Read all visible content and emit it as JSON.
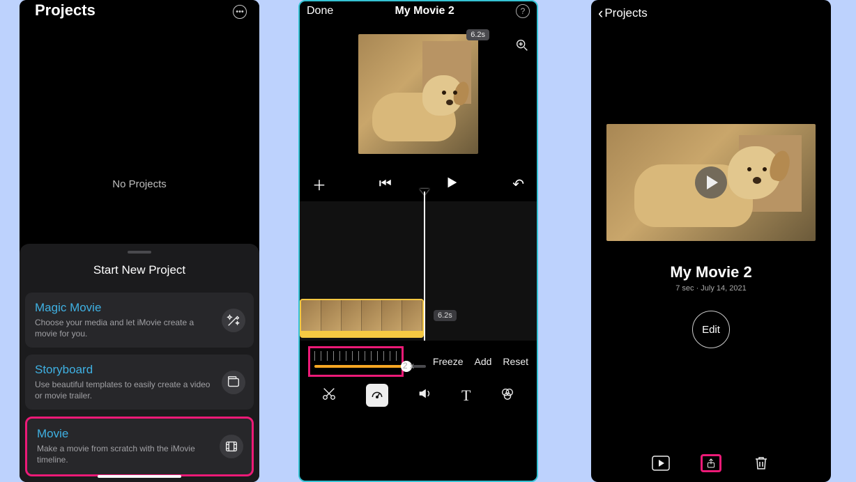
{
  "screen1": {
    "title": "Projects",
    "no_projects": "No Projects",
    "start_heading": "Start New Project",
    "items": [
      {
        "title": "Magic Movie",
        "desc": "Choose your media and let iMovie create a movie for you."
      },
      {
        "title": "Storyboard",
        "desc": "Use beautiful templates to easily create a video or movie trailer."
      },
      {
        "title": "Movie",
        "desc": "Make a movie from scratch with the iMovie timeline."
      }
    ]
  },
  "screen2": {
    "done": "Done",
    "title": "My Movie 2",
    "clip_duration": "6.2s",
    "timeline_time": "6.2s",
    "speed_multiplier": "2 x",
    "buttons": {
      "freeze": "Freeze",
      "add": "Add",
      "reset": "Reset"
    }
  },
  "screen3": {
    "back": "Projects",
    "title": "My Movie 2",
    "meta": "7 sec · July 14, 2021",
    "edit": "Edit"
  },
  "colors": {
    "accent": "#3fb1e3",
    "highlight": "#ec1a77",
    "speed_fill": "#f6a623"
  }
}
